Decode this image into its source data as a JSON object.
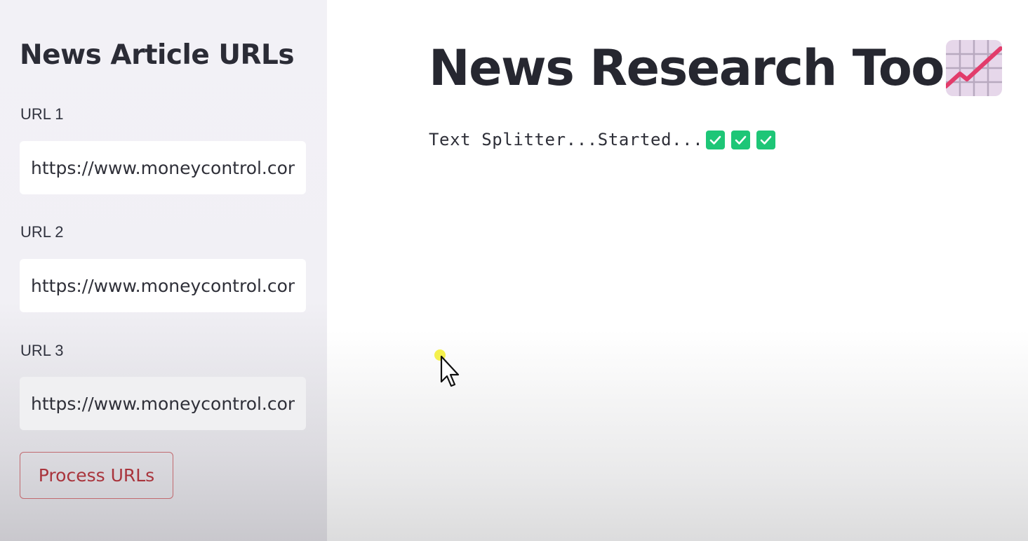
{
  "sidebar": {
    "title": "News Article URLs",
    "fields": [
      {
        "label": "URL 1",
        "value": "https://www.moneycontrol.com"
      },
      {
        "label": "URL 2",
        "value": "https://www.moneycontrol.com"
      },
      {
        "label": "URL 3",
        "value": "https://www.moneycontrol.com"
      }
    ],
    "process_button": "Process URLs"
  },
  "main": {
    "title": "News Research Tool",
    "title_icon": "chart-increasing-icon",
    "status_text": "Text Splitter...Started...",
    "status_icons": [
      "check-mark-icon",
      "check-mark-icon",
      "check-mark-icon"
    ]
  },
  "colors": {
    "sidebar_bg": "#f0f0f5",
    "accent": "#a9343c",
    "check_green": "#1ec677",
    "chart_bg": "#e6d7ea",
    "chart_line": "#e23c6b"
  }
}
